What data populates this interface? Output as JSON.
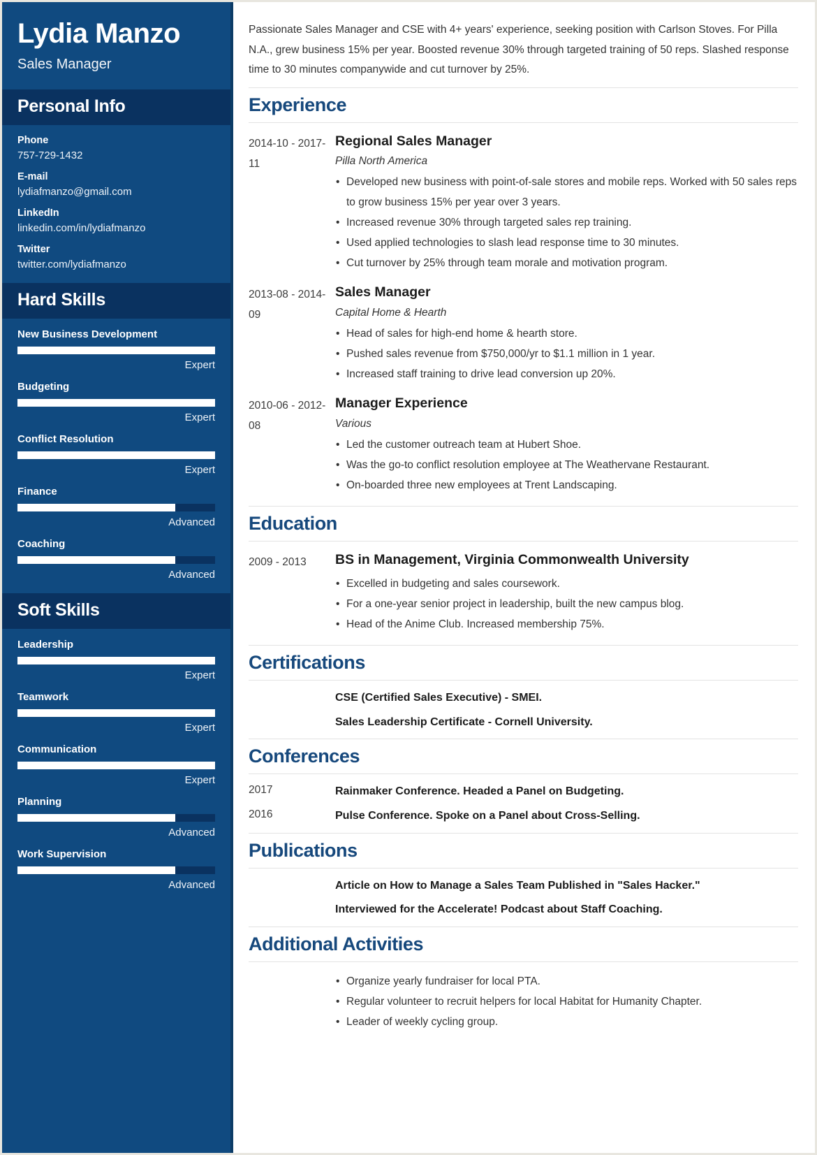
{
  "theme": {
    "sidebar_bg": "#104a80",
    "sidebar_head_bg": "#0a3260",
    "accent_heading": "#16487c",
    "text": "#333333"
  },
  "header": {
    "full_name": "Lydia Manzo",
    "job_title": "Sales Manager"
  },
  "summary": "Passionate Sales Manager and CSE with 4+ years' experience, seeking position with Carlson Stoves. For Pilla N.A., grew business 15% per year. Boosted revenue 30% through targeted training of 50 reps. Slashed response time to 30 minutes companywide and cut turnover by 25%.",
  "sidebar": {
    "personal_info": {
      "heading": "Personal Info",
      "items": [
        {
          "label": "Phone",
          "value": "757-729-1432"
        },
        {
          "label": "E-mail",
          "value": "lydiafmanzo@gmail.com"
        },
        {
          "label": "LinkedIn",
          "value": "linkedin.com/in/lydiafmanzo"
        },
        {
          "label": "Twitter",
          "value": "twitter.com/lydiafmanzo"
        }
      ]
    },
    "hard_skills": {
      "heading": "Hard Skills",
      "items": [
        {
          "name": "New Business Development",
          "level": "Expert",
          "percent": 100
        },
        {
          "name": "Budgeting",
          "level": "Expert",
          "percent": 100
        },
        {
          "name": "Conflict Resolution",
          "level": "Expert",
          "percent": 100
        },
        {
          "name": "Finance",
          "level": "Advanced",
          "percent": 80
        },
        {
          "name": "Coaching",
          "level": "Advanced",
          "percent": 80
        }
      ]
    },
    "soft_skills": {
      "heading": "Soft Skills",
      "items": [
        {
          "name": "Leadership",
          "level": "Expert",
          "percent": 100
        },
        {
          "name": "Teamwork",
          "level": "Expert",
          "percent": 100
        },
        {
          "name": "Communication",
          "level": "Expert",
          "percent": 100
        },
        {
          "name": "Planning",
          "level": "Advanced",
          "percent": 80
        },
        {
          "name": "Work Supervision",
          "level": "Advanced",
          "percent": 80
        }
      ]
    }
  },
  "sections": {
    "experience": {
      "heading": "Experience",
      "entries": [
        {
          "dates": "2014-10 - 2017-11",
          "title": "Regional Sales Manager",
          "subtitle": "Pilla North America",
          "bullets": [
            "Developed new business with point-of-sale stores and mobile reps. Worked with 50 sales reps to grow business 15% per year over 3 years.",
            "Increased revenue 30% through targeted sales rep training.",
            "Used applied technologies to slash lead response time to 30 minutes.",
            "Cut turnover by 25% through team morale and motivation program."
          ]
        },
        {
          "dates": "2013-08 - 2014-09",
          "title": "Sales Manager",
          "subtitle": "Capital Home & Hearth",
          "bullets": [
            "Head of sales for high-end home & hearth store.",
            "Pushed sales revenue from $750,000/yr to $1.1 million in 1 year.",
            "Increased staff training to drive lead conversion up 20%."
          ]
        },
        {
          "dates": "2010-06 - 2012-08",
          "title": "Manager Experience",
          "subtitle": "Various",
          "bullets": [
            "Led the customer outreach team at Hubert Shoe.",
            "Was the go-to conflict resolution employee at The Weathervane Restaurant.",
            "On-boarded three new employees at Trent Landscaping."
          ]
        }
      ]
    },
    "education": {
      "heading": "Education",
      "entries": [
        {
          "dates": "2009 - 2013",
          "title": "BS in Management, Virginia Commonwealth University",
          "subtitle": "",
          "bullets": [
            "Excelled in budgeting and sales coursework.",
            "For a one-year senior project in leadership, built the new campus blog.",
            "Head of the Anime Club. Increased membership 75%."
          ]
        }
      ]
    },
    "certifications": {
      "heading": "Certifications",
      "entries": [
        {
          "dates": "",
          "text": "CSE (Certified Sales Executive) - SMEI."
        },
        {
          "dates": "",
          "text": "Sales Leadership Certificate - Cornell University."
        }
      ]
    },
    "conferences": {
      "heading": "Conferences",
      "entries": [
        {
          "dates": "2017",
          "text": "Rainmaker Conference. Headed a Panel on Budgeting."
        },
        {
          "dates": "2016",
          "text": "Pulse Conference. Spoke on a Panel about Cross-Selling."
        }
      ]
    },
    "publications": {
      "heading": "Publications",
      "entries": [
        {
          "dates": "",
          "text": "Article on How to Manage a Sales Team Published in \"Sales Hacker.\""
        },
        {
          "dates": "",
          "text": "Interviewed for the Accelerate! Podcast about Staff Coaching."
        }
      ]
    },
    "additional_activities": {
      "heading": "Additional Activities",
      "bullets": [
        "Organize yearly fundraiser for local PTA.",
        "Regular volunteer to recruit helpers for local Habitat for Humanity Chapter.",
        "Leader of weekly cycling group."
      ]
    }
  }
}
